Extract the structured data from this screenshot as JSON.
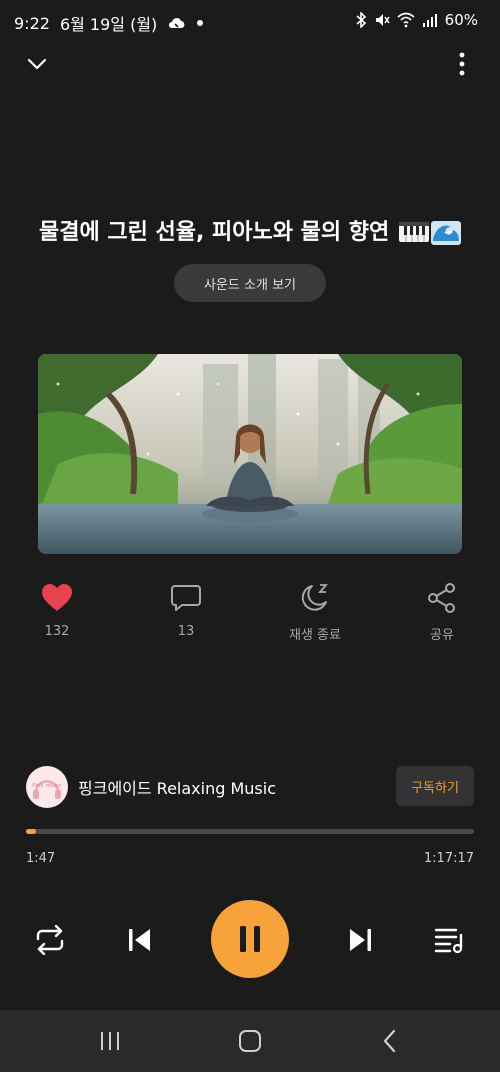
{
  "status_bar": {
    "time": "9:22",
    "date": "6월 19일 (월)",
    "battery": "60%",
    "icons": [
      "cloud-icon",
      "dot-icon",
      "bluetooth-icon",
      "mute-icon",
      "wifi-icon",
      "signal-icon"
    ]
  },
  "player": {
    "title": "물결에 그린 선율, 피아노와 물의 향연",
    "title_emojis": [
      "piano-icon",
      "wave-icon"
    ],
    "intro_button": "사운드 소개 보기",
    "actions": {
      "like_count": "132",
      "comment_count": "13",
      "sleep_label": "재생 종료",
      "share_label": "공유"
    },
    "channel": {
      "avatar_text": "Pink music",
      "name": "핑크에이드 Relaxing Music",
      "subscribe_label": "구독하기"
    },
    "progress": {
      "current": "1:47",
      "total": "1:17:17",
      "fraction": 0.023
    }
  },
  "colors": {
    "background": "#1b1b1b",
    "accent": "#f7a23a",
    "like": "#e8434f"
  }
}
